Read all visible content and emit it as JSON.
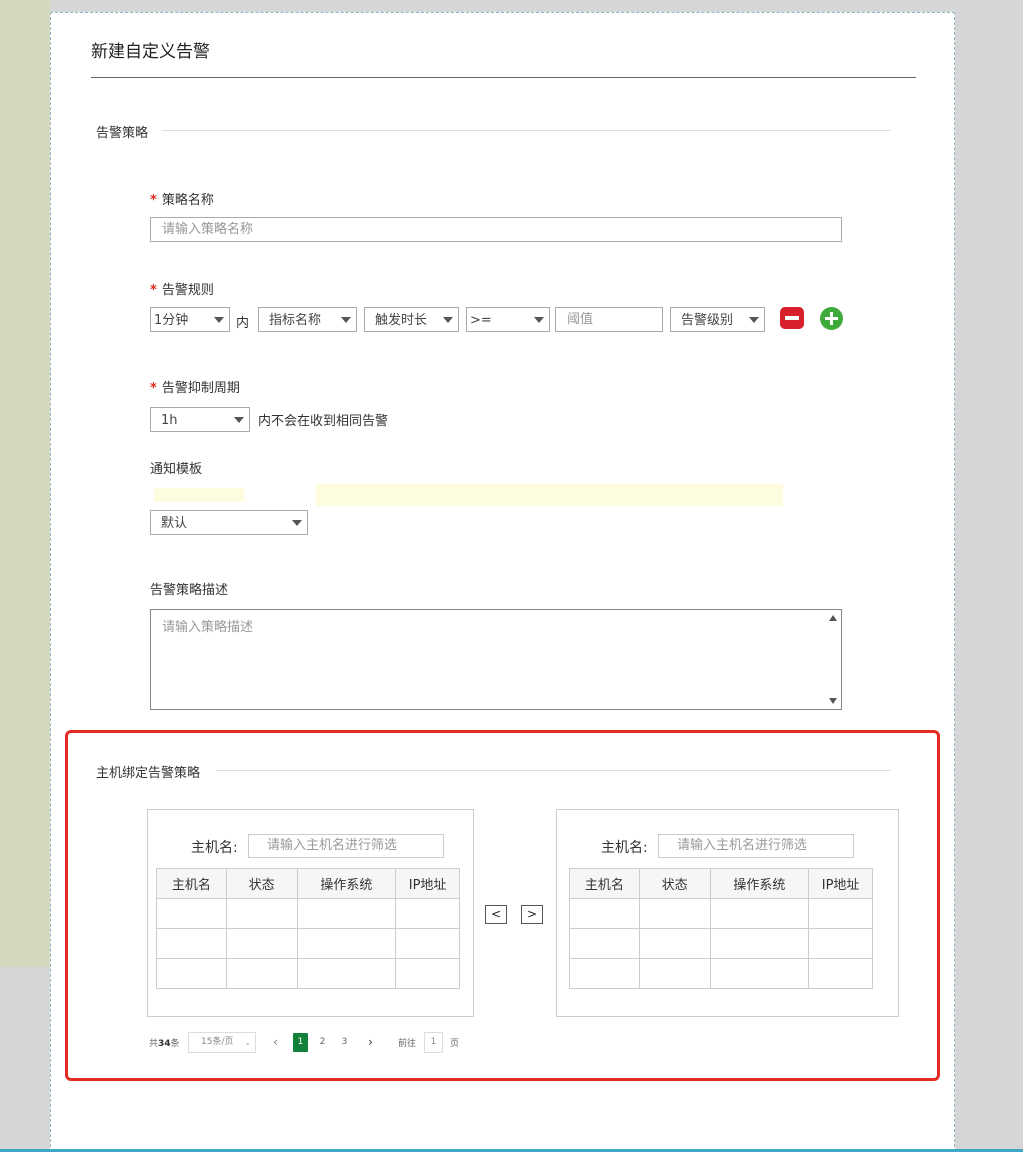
{
  "dialog": {
    "title": "新建自定义告警"
  },
  "sections": {
    "policy": "告警策略",
    "binding": "主机绑定告警策略"
  },
  "form": {
    "name": {
      "label": "策略名称",
      "placeholder": "请输入策略名称"
    },
    "rule": {
      "label": "告警规则",
      "period": "1分钟",
      "within_text": "内",
      "metric": "指标名称",
      "duration": "触发时长",
      "operator": ">=",
      "threshold_placeholder": "阈值",
      "level": "告警级别",
      "remove_icon": "minus-square-icon",
      "add_icon": "plus-circle-icon"
    },
    "suppress": {
      "label": "告警抑制周期",
      "value": "1h",
      "suffix": "内不会在收到相同告警"
    },
    "template": {
      "label": "通知模板",
      "value": "默认"
    },
    "description": {
      "label": "告警策略描述",
      "placeholder": "请输入策略描述"
    }
  },
  "hosts": {
    "left": {
      "filter_label": "主机名:",
      "filter_placeholder": "请输入主机名进行筛选",
      "columns": [
        "主机名",
        "状态",
        "操作系统",
        "IP地址"
      ]
    },
    "right": {
      "filter_label": "主机名:",
      "filter_placeholder": "请输入主机名进行筛选",
      "columns": [
        "主机名",
        "状态",
        "操作系统",
        "IP地址"
      ]
    },
    "move_left": "<",
    "move_right": ">"
  },
  "pagination": {
    "total_prefix": "共",
    "total": "34",
    "total_suffix": "条",
    "page_size": "15条/页",
    "prev": "‹",
    "pages": [
      "1",
      "2",
      "3"
    ],
    "next": "›",
    "goto_prefix": "前往",
    "goto_value": "1",
    "goto_suffix": "页"
  },
  "colors": {
    "required": "#e0281f",
    "highlight_box": "#e52c22",
    "page_active": "#11813a",
    "remove_btn": "#d8202c",
    "add_btn": "#3daa3a"
  }
}
